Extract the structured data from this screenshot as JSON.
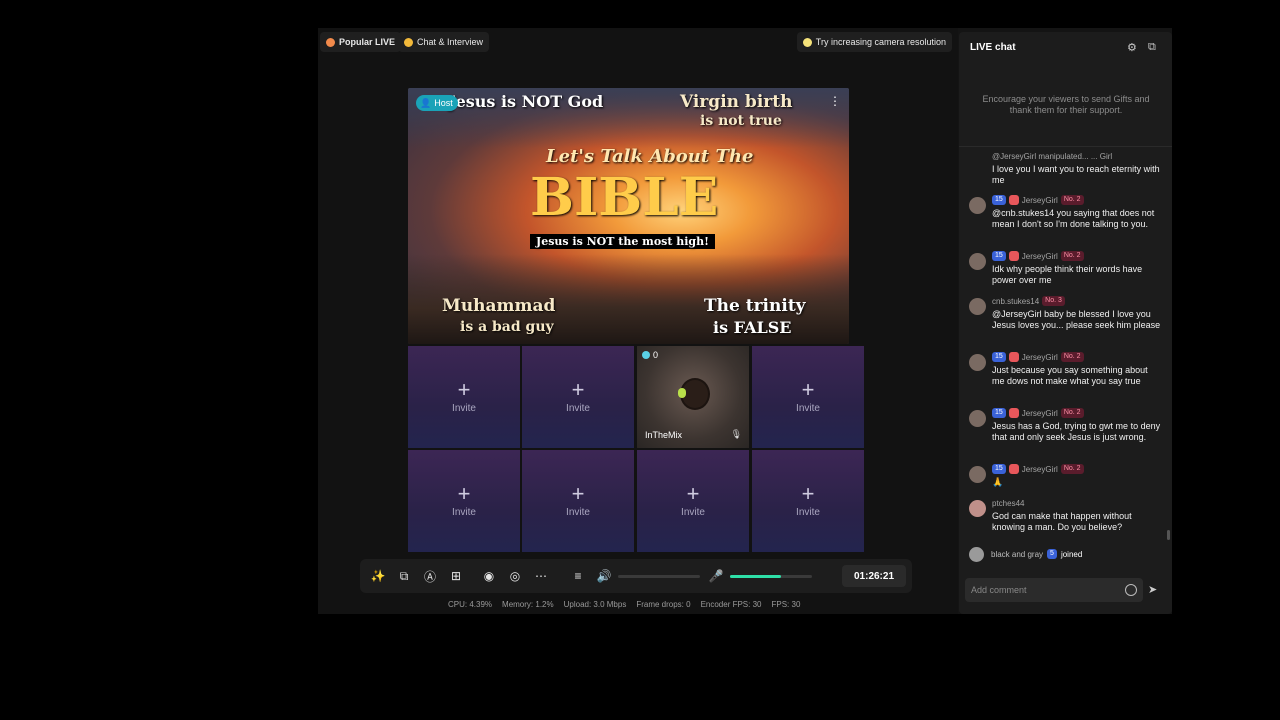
{
  "topbar": {
    "popular_live": "Popular LIVE",
    "chat_interview": "Chat & Interview",
    "tip": "Try increasing camera resolution"
  },
  "video": {
    "host_label": "Host",
    "top_left": "Jesus is NOT God",
    "top_right_1": "Virgin birth",
    "top_right_2": "is not true",
    "center_1": "Let's Talk About The",
    "center_2": "BIBLE",
    "center_3": "Jesus is NOT the most high!",
    "bottom_left_1": "Muhammad",
    "bottom_left_2": "is a bad guy",
    "bottom_right_1": "The trinity",
    "bottom_right_2": "is FALSE"
  },
  "guests": {
    "invite_label": "Invite",
    "cam_count": "0",
    "cam_name": "InTheMix"
  },
  "toolbar": {
    "timer": "01:26:21",
    "volume_level": 0,
    "mic_level": 0.62
  },
  "stats": {
    "cpu": "CPU: 4.39%",
    "memory": "Memory: 1.2%",
    "upload": "Upload: 3.0 Mbps",
    "frame_drops": "Frame drops: 0",
    "encoder_fps": "Encoder FPS: 30",
    "fps": "FPS: 30"
  },
  "chat": {
    "title": "LIVE chat",
    "encourage": "Encourage your viewers to send Gifts and thank them for their support.",
    "messages": [
      {
        "header": "@JerseyGirl manipulated... ... Girl",
        "level": "",
        "rank": "",
        "text": "I love you I want you to reach eternity with me"
      },
      {
        "header": "JerseyGirl",
        "level": "15",
        "rank": "No. 2",
        "text": "@cnb.stukes14 you saying that does not mean I don't so I'm done talking to you."
      },
      {
        "header": "JerseyGirl",
        "level": "15",
        "rank": "No. 2",
        "text": "Idk why people think their words have power over me"
      },
      {
        "header": "cnb.stukes14",
        "level": "",
        "rank": "No. 3",
        "text": "@JerseyGirl baby be blessed I love you Jesus loves you... please seek him please"
      },
      {
        "header": "JerseyGirl",
        "level": "15",
        "rank": "No. 2",
        "text": "Just because you say something about me dows not make what you say true"
      },
      {
        "header": "JerseyGirl",
        "level": "15",
        "rank": "No. 2",
        "text": "Jesus has a God, trying to gwt me to deny that and only seek Jesus is just wrong."
      },
      {
        "header": "JerseyGirl",
        "level": "15",
        "rank": "No. 2",
        "text": "🙏"
      },
      {
        "header": "ptches44",
        "level": "",
        "rank": "",
        "text": "God can make that happen without knowing a man. Do you believe?"
      }
    ],
    "joined_user": "black and gray",
    "joined_level": "5",
    "joined_text": "joined",
    "comment_placeholder": "Add comment"
  },
  "colors": {
    "accent_green": "#2ee0a8",
    "host_badge": "#1aa3b8",
    "level_badge": "#3a62d8",
    "invite_tile": "#2a2248"
  }
}
